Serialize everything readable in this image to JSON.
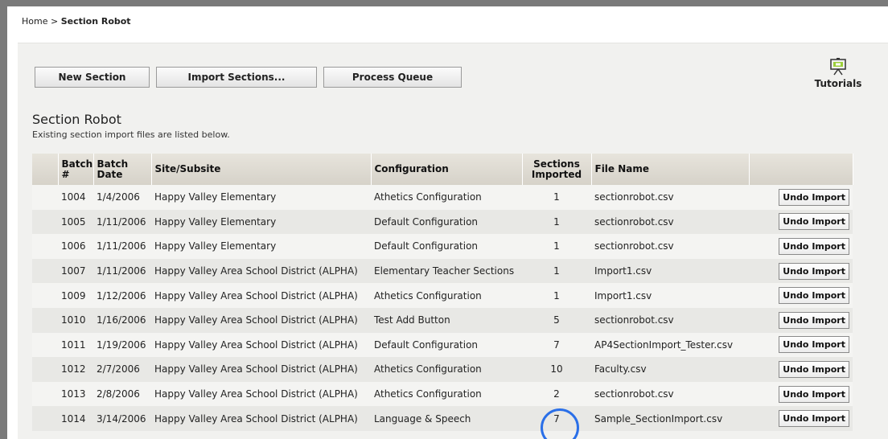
{
  "breadcrumb": {
    "home": "Home",
    "separator": " > ",
    "current": "Section Robot"
  },
  "toolbar": {
    "new_section": "New Section",
    "import_sections": "Import Sections...",
    "process_queue": "Process Queue",
    "tutorials": "Tutorials"
  },
  "page": {
    "title": "Section Robot",
    "subtitle": "Existing section import files are listed below."
  },
  "table": {
    "headers": {
      "batch_num": "Batch #",
      "batch_date": "Batch Date",
      "site": "Site/Subsite",
      "configuration": "Configuration",
      "sections_imported": "Sections Imported",
      "file_name": "File Name"
    },
    "undo_label": "Undo Import",
    "rows": [
      {
        "batch": "1004",
        "date": "1/4/2006",
        "site": "Happy Valley Elementary",
        "config": "Athetics Configuration",
        "sections": "1",
        "file": "sectionrobot.csv"
      },
      {
        "batch": "1005",
        "date": "1/11/2006",
        "site": "Happy Valley Elementary",
        "config": "Default Configuration",
        "sections": "1",
        "file": "sectionrobot.csv"
      },
      {
        "batch": "1006",
        "date": "1/11/2006",
        "site": "Happy Valley Elementary",
        "config": "Default Configuration",
        "sections": "1",
        "file": "sectionrobot.csv"
      },
      {
        "batch": "1007",
        "date": "1/11/2006",
        "site": "Happy Valley Area School District (ALPHA)",
        "config": "Elementary Teacher Sections",
        "sections": "1",
        "file": "Import1.csv"
      },
      {
        "batch": "1009",
        "date": "1/12/2006",
        "site": "Happy Valley Area School District (ALPHA)",
        "config": "Athetics Configuration",
        "sections": "1",
        "file": "Import1.csv"
      },
      {
        "batch": "1010",
        "date": "1/16/2006",
        "site": "Happy Valley Area School District (ALPHA)",
        "config": "Test Add Button",
        "sections": "5",
        "file": "sectionrobot.csv"
      },
      {
        "batch": "1011",
        "date": "1/19/2006",
        "site": "Happy Valley Area School District (ALPHA)",
        "config": "Default Configuration",
        "sections": "7",
        "file": "AP4SectionImport_Tester.csv"
      },
      {
        "batch": "1012",
        "date": "2/7/2006",
        "site": "Happy Valley Area School District (ALPHA)",
        "config": "Athetics Configuration",
        "sections": "10",
        "file": "Faculty.csv"
      },
      {
        "batch": "1013",
        "date": "2/8/2006",
        "site": "Happy Valley Area School District (ALPHA)",
        "config": "Athetics Configuration",
        "sections": "2",
        "file": "sectionrobot.csv"
      },
      {
        "batch": "1014",
        "date": "3/14/2006",
        "site": "Happy Valley Area School District (ALPHA)",
        "config": "Language & Speech",
        "sections": "7",
        "file": "Sample_SectionImport.csv"
      }
    ]
  },
  "colors": {
    "highlight": "#2a6fe8",
    "header_bg": "#d6d2c9",
    "panel_bg": "#f1f1ef"
  }
}
